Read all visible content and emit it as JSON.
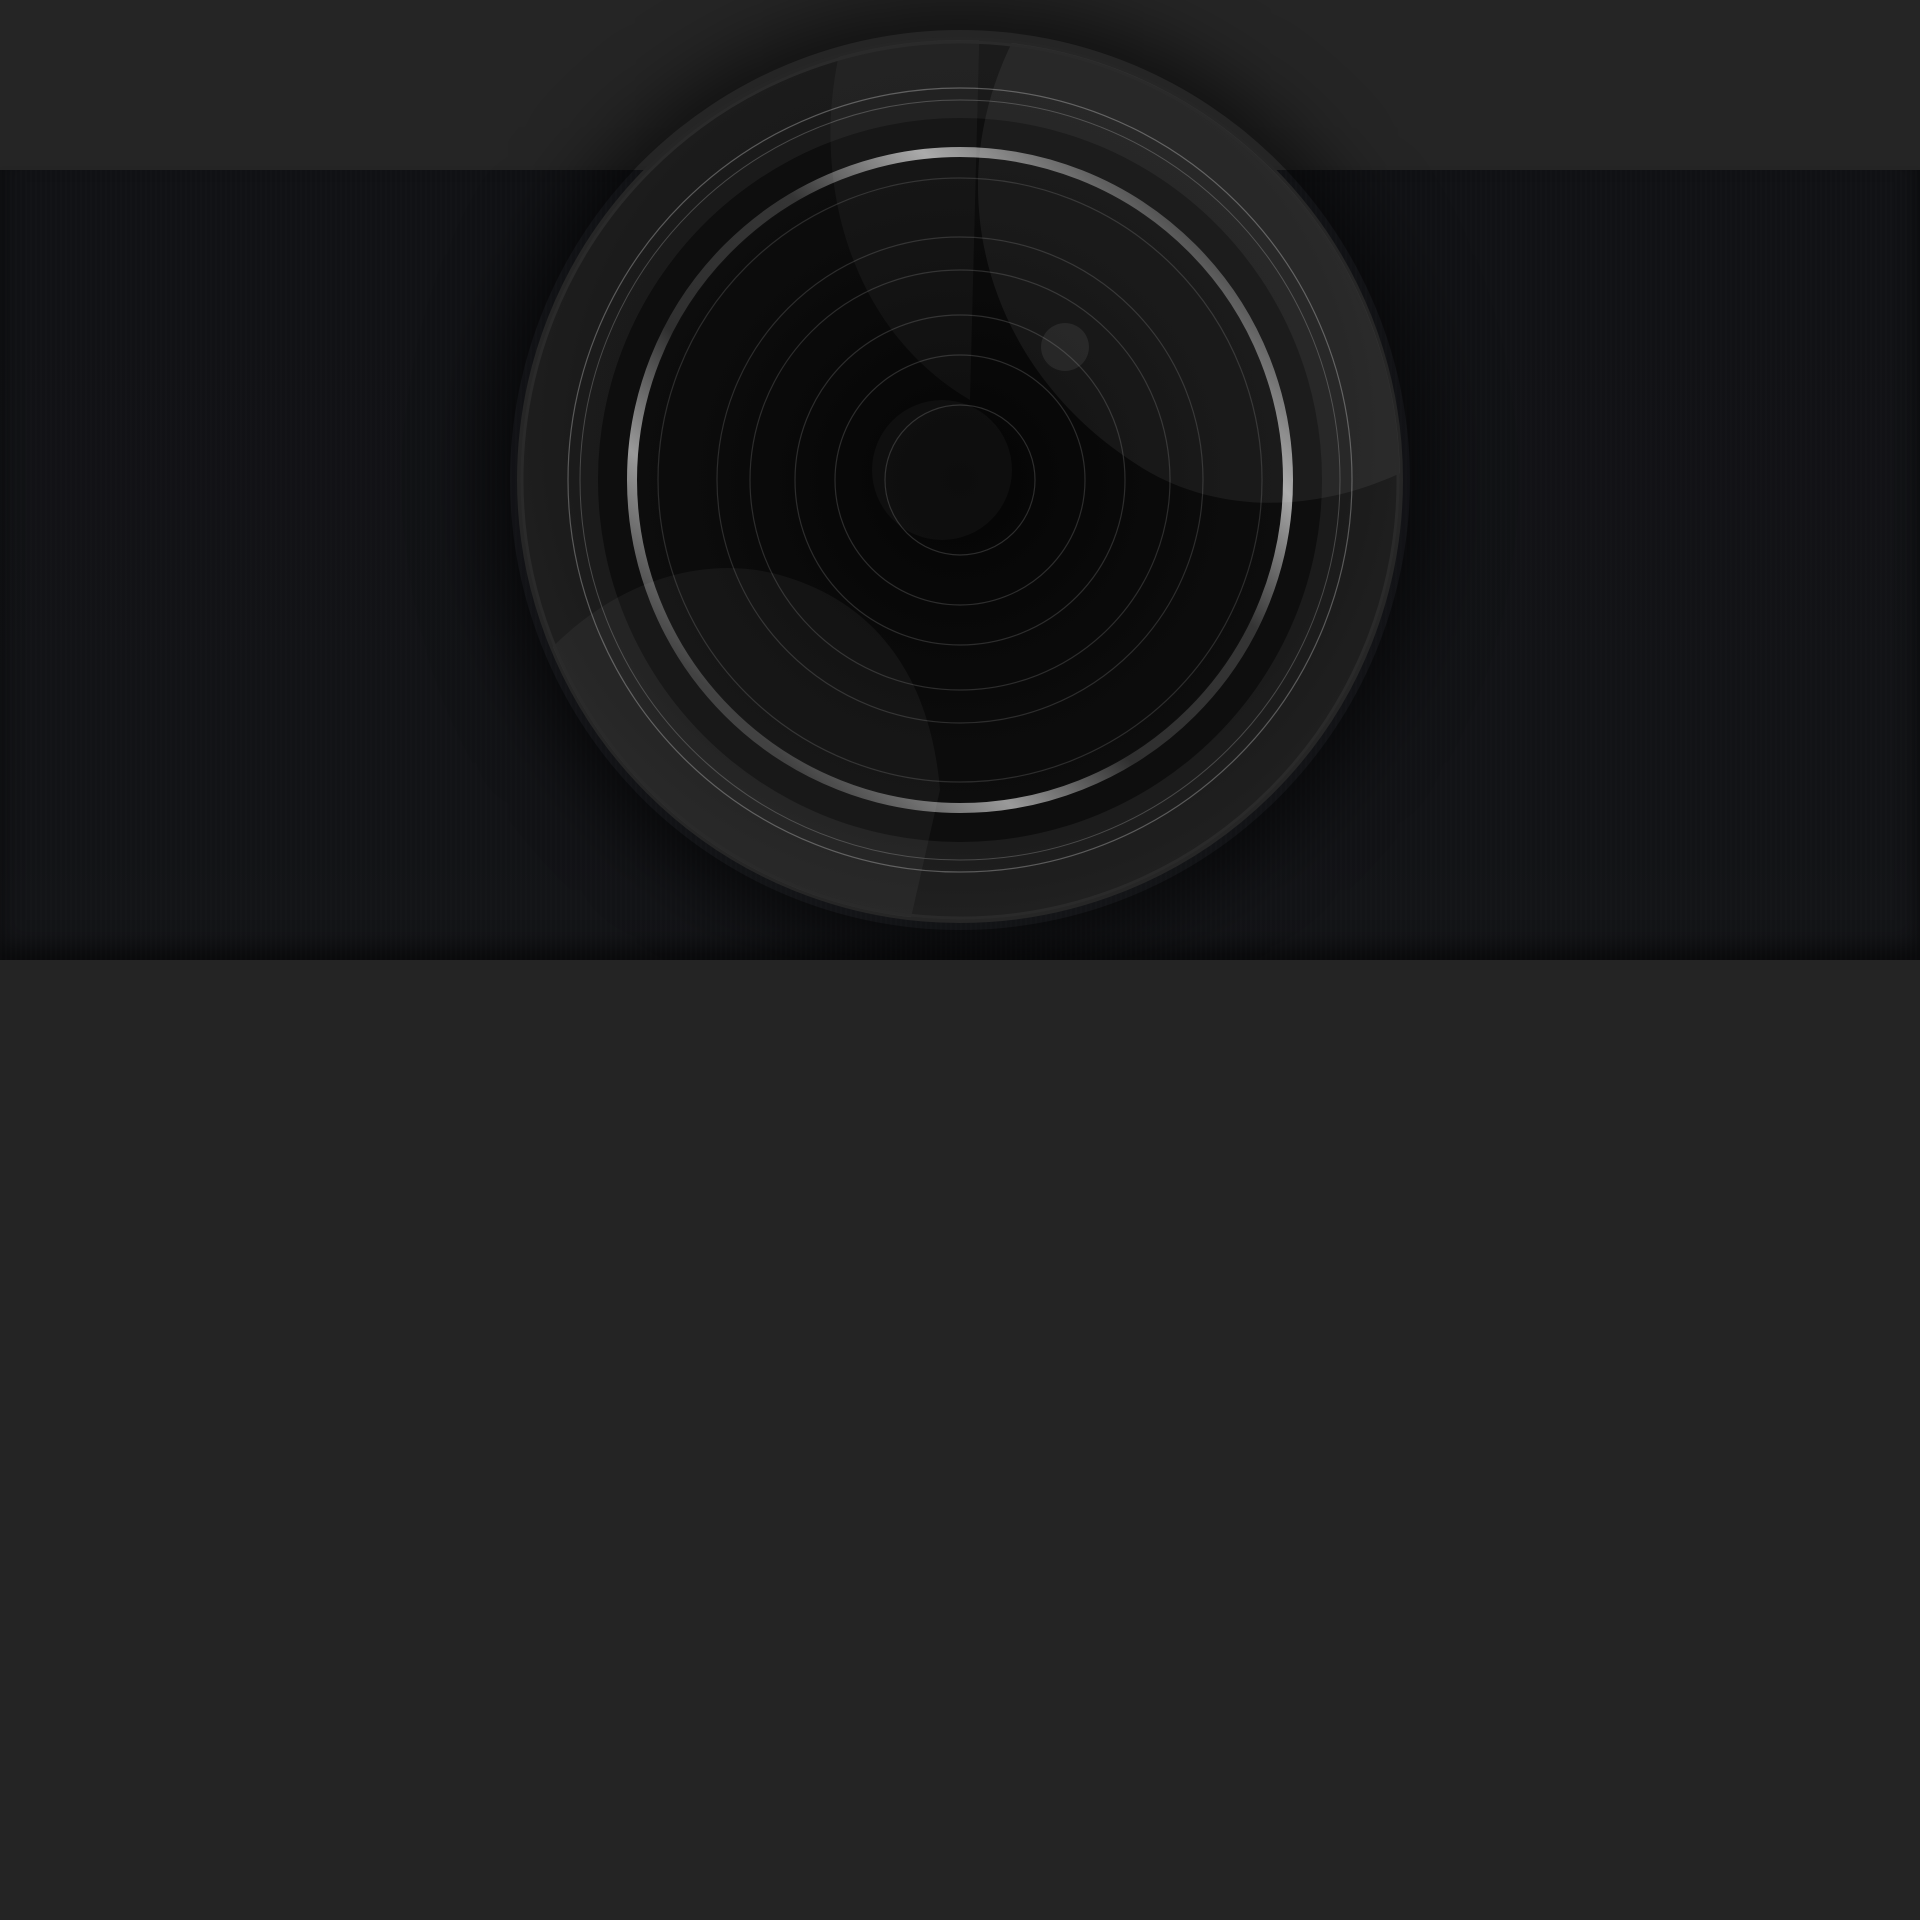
{
  "screen": {
    "background_color": "#242424",
    "band_color": "#121316"
  },
  "camera_lens": {
    "icon": "camera-lens-icon",
    "ring_color": "#8a8a8a",
    "glass_color": "#0a0a0a"
  }
}
